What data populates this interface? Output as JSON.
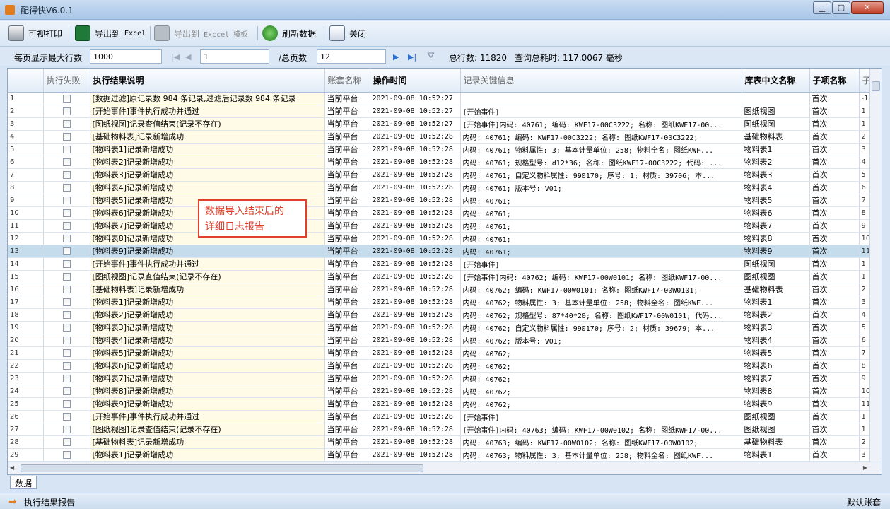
{
  "window": {
    "title": "配得快V6.0.1"
  },
  "toolbar": {
    "print": "可视打印",
    "export_excel": "导出到",
    "export_excel_sub": "Excel",
    "export_template": "导出到",
    "export_template_sub": "Exccel 模板",
    "refresh": "刷新数据",
    "close": "关闭"
  },
  "paging": {
    "max_rows_label": "每页显示最大行数",
    "max_rows_value": "1000",
    "page_value": "1",
    "total_pages_label": "/总页数",
    "total_pages_value": "12",
    "total_rows": "总行数: 11820",
    "query_time": "查询总耗时: 117.0067 毫秒"
  },
  "grid": {
    "headers": [
      "执行失败",
      "执行结果说明",
      "账套名称",
      "操作时间",
      "记录关键信息",
      "库表中文名称",
      "子项名称",
      "子"
    ],
    "rows": [
      {
        "n": "1",
        "desc": "[数据过滤]原记录数 984 条记录,过滤后记录数 984 条记录",
        "acct": "当前平台",
        "time": "2021-09-08 10:52:27",
        "key": "",
        "table": "",
        "sub": "首次",
        "x": "-1"
      },
      {
        "n": "2",
        "desc": "[开始事件]事件执行成功并通过",
        "acct": "当前平台",
        "time": "2021-09-08 10:52:27",
        "key": "[开始事件]",
        "table": "图纸视图",
        "sub": "首次",
        "x": "1"
      },
      {
        "n": "3",
        "desc": "[图纸视图]记录查值结束(记录不存在)",
        "acct": "当前平台",
        "time": "2021-09-08 10:52:27",
        "key": "[开始事件]内码: 40761; 编码: KWF17-00C3222; 名称: 图纸KWF17-00...",
        "table": "图纸视图",
        "sub": "首次",
        "x": "1"
      },
      {
        "n": "4",
        "desc": "[基础物料表]记录新增成功",
        "acct": "当前平台",
        "time": "2021-09-08 10:52:28",
        "key": "内码: 40761; 编码: KWF17-00C3222; 名称: 图纸KWF17-00C3222;",
        "table": "基础物料表",
        "sub": "首次",
        "x": "2"
      },
      {
        "n": "5",
        "desc": "[物料表1]记录新增成功",
        "acct": "当前平台",
        "time": "2021-09-08 10:52:28",
        "key": "内码: 40761; 物料属性: 3; 基本计量单位: 258; 物料全名: 图纸KWF...",
        "table": "物料表1",
        "sub": "首次",
        "x": "3"
      },
      {
        "n": "6",
        "desc": "[物料表2]记录新增成功",
        "acct": "当前平台",
        "time": "2021-09-08 10:52:28",
        "key": "内码: 40761; 规格型号: d12*36; 名称: 图纸KWF17-00C3222; 代码: ...",
        "table": "物料表2",
        "sub": "首次",
        "x": "4"
      },
      {
        "n": "7",
        "desc": "[物料表3]记录新增成功",
        "acct": "当前平台",
        "time": "2021-09-08 10:52:28",
        "key": "内码: 40761; 自定义物料属性: 990170; 序号: 1; 材质: 39706; 本...",
        "table": "物料表3",
        "sub": "首次",
        "x": "5"
      },
      {
        "n": "8",
        "desc": "[物料表4]记录新增成功",
        "acct": "当前平台",
        "time": "2021-09-08 10:52:28",
        "key": "内码: 40761; 版本号: V01;",
        "table": "物料表4",
        "sub": "首次",
        "x": "6"
      },
      {
        "n": "9",
        "desc": "[物料表5]记录新增成功",
        "acct": "当前平台",
        "time": "2021-09-08 10:52:28",
        "key": "内码: 40761;",
        "table": "物料表5",
        "sub": "首次",
        "x": "7"
      },
      {
        "n": "10",
        "desc": "[物料表6]记录新增成功",
        "acct": "当前平台",
        "time": "2021-09-08 10:52:28",
        "key": "内码: 40761;",
        "table": "物料表6",
        "sub": "首次",
        "x": "8"
      },
      {
        "n": "11",
        "desc": "[物料表7]记录新增成功",
        "acct": "当前平台",
        "time": "2021-09-08 10:52:28",
        "key": "内码: 40761;",
        "table": "物料表7",
        "sub": "首次",
        "x": "9"
      },
      {
        "n": "12",
        "desc": "[物料表8]记录新增成功",
        "acct": "当前平台",
        "time": "2021-09-08 10:52:28",
        "key": "内码: 40761;",
        "table": "物料表8",
        "sub": "首次",
        "x": "10"
      },
      {
        "n": "13",
        "desc": "[物料表9]记录新增成功",
        "acct": "当前平台",
        "time": "2021-09-08 10:52:28",
        "key": "内码: 40761;",
        "table": "物料表9",
        "sub": "首次",
        "x": "11",
        "selected": true
      },
      {
        "n": "14",
        "desc": "[开始事件]事件执行成功并通过",
        "acct": "当前平台",
        "time": "2021-09-08 10:52:28",
        "key": "[开始事件]",
        "table": "图纸视图",
        "sub": "首次",
        "x": "1"
      },
      {
        "n": "15",
        "desc": "[图纸视图]记录查值结束(记录不存在)",
        "acct": "当前平台",
        "time": "2021-09-08 10:52:28",
        "key": "[开始事件]内码: 40762; 编码: KWF17-00W0101; 名称: 图纸KWF17-00...",
        "table": "图纸视图",
        "sub": "首次",
        "x": "1"
      },
      {
        "n": "16",
        "desc": "[基础物料表]记录新增成功",
        "acct": "当前平台",
        "time": "2021-09-08 10:52:28",
        "key": "内码: 40762; 编码: KWF17-00W0101; 名称: 图纸KWF17-00W0101;",
        "table": "基础物料表",
        "sub": "首次",
        "x": "2"
      },
      {
        "n": "17",
        "desc": "[物料表1]记录新增成功",
        "acct": "当前平台",
        "time": "2021-09-08 10:52:28",
        "key": "内码: 40762; 物料属性: 3; 基本计量单位: 258; 物料全名: 图纸KWF...",
        "table": "物料表1",
        "sub": "首次",
        "x": "3"
      },
      {
        "n": "18",
        "desc": "[物料表2]记录新增成功",
        "acct": "当前平台",
        "time": "2021-09-08 10:52:28",
        "key": "内码: 40762; 规格型号: 87*40*20; 名称: 图纸KWF17-00W0101; 代码...",
        "table": "物料表2",
        "sub": "首次",
        "x": "4"
      },
      {
        "n": "19",
        "desc": "[物料表3]记录新增成功",
        "acct": "当前平台",
        "time": "2021-09-08 10:52:28",
        "key": "内码: 40762; 自定义物料属性: 990170; 序号: 2; 材质: 39679; 本...",
        "table": "物料表3",
        "sub": "首次",
        "x": "5"
      },
      {
        "n": "20",
        "desc": "[物料表4]记录新增成功",
        "acct": "当前平台",
        "time": "2021-09-08 10:52:28",
        "key": "内码: 40762; 版本号: V01;",
        "table": "物料表4",
        "sub": "首次",
        "x": "6"
      },
      {
        "n": "21",
        "desc": "[物料表5]记录新增成功",
        "acct": "当前平台",
        "time": "2021-09-08 10:52:28",
        "key": "内码: 40762;",
        "table": "物料表5",
        "sub": "首次",
        "x": "7"
      },
      {
        "n": "22",
        "desc": "[物料表6]记录新增成功",
        "acct": "当前平台",
        "time": "2021-09-08 10:52:28",
        "key": "内码: 40762;",
        "table": "物料表6",
        "sub": "首次",
        "x": "8"
      },
      {
        "n": "23",
        "desc": "[物料表7]记录新增成功",
        "acct": "当前平台",
        "time": "2021-09-08 10:52:28",
        "key": "内码: 40762;",
        "table": "物料表7",
        "sub": "首次",
        "x": "9"
      },
      {
        "n": "24",
        "desc": "[物料表8]记录新增成功",
        "acct": "当前平台",
        "time": "2021-09-08 10:52:28",
        "key": "内码: 40762;",
        "table": "物料表8",
        "sub": "首次",
        "x": "10"
      },
      {
        "n": "25",
        "desc": "[物料表9]记录新增成功",
        "acct": "当前平台",
        "time": "2021-09-08 10:52:28",
        "key": "内码: 40762;",
        "table": "物料表9",
        "sub": "首次",
        "x": "11"
      },
      {
        "n": "26",
        "desc": "[开始事件]事件执行成功并通过",
        "acct": "当前平台",
        "time": "2021-09-08 10:52:28",
        "key": "[开始事件]",
        "table": "图纸视图",
        "sub": "首次",
        "x": "1"
      },
      {
        "n": "27",
        "desc": "[图纸视图]记录查值结束(记录不存在)",
        "acct": "当前平台",
        "time": "2021-09-08 10:52:28",
        "key": "[开始事件]内码: 40763; 编码: KWF17-00W0102; 名称: 图纸KWF17-00...",
        "table": "图纸视图",
        "sub": "首次",
        "x": "1"
      },
      {
        "n": "28",
        "desc": "[基础物料表]记录新增成功",
        "acct": "当前平台",
        "time": "2021-09-08 10:52:28",
        "key": "内码: 40763; 编码: KWF17-00W0102; 名称: 图纸KWF17-00W0102;",
        "table": "基础物料表",
        "sub": "首次",
        "x": "2"
      },
      {
        "n": "29",
        "desc": "[物料表1]记录新增成功",
        "acct": "当前平台",
        "time": "2021-09-08 10:52:28",
        "key": "内码: 40763; 物料属性: 3; 基本计量单位: 258; 物料全名: 图纸KWF...",
        "table": "物料表1",
        "sub": "首次",
        "x": "3"
      }
    ]
  },
  "callout": {
    "line1": "数据导入结束后的",
    "line2": "详细日志报告"
  },
  "tabs": {
    "data": "数据"
  },
  "status": {
    "left": "执行结果报告",
    "right": "默认账套"
  }
}
